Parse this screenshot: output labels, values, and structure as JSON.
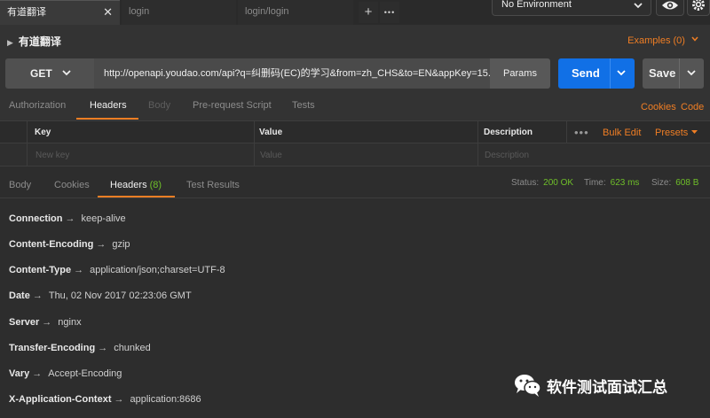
{
  "tabs": [
    {
      "label": "有道翻译",
      "active": true
    },
    {
      "label": "login",
      "active": false
    },
    {
      "label": "login/login",
      "active": false
    }
  ],
  "tab_actions": {
    "new_tab": "+",
    "more": "•••"
  },
  "environment": {
    "selected": "No Environment"
  },
  "request": {
    "title": "有道翻译",
    "examples_label": "Examples (0)",
    "method": "GET",
    "url": "http://openapi.youdao.com/api?q=纠删码(EC)的学习&from=zh_CHS&to=EN&appKey=15...",
    "params_label": "Params",
    "send_label": "Send",
    "save_label": "Save"
  },
  "request_tabs": [
    "Authorization",
    "Headers",
    "Body",
    "Pre-request Script",
    "Tests"
  ],
  "request_tab_links": {
    "cookies": "Cookies",
    "code": "Code"
  },
  "headers_table": {
    "columns": [
      "Key",
      "Value",
      "Description"
    ],
    "placeholders": {
      "key": "New key",
      "value": "Value",
      "description": "Description"
    },
    "more": "•••",
    "bulk_edit": "Bulk Edit",
    "presets": "Presets"
  },
  "response_tabs": [
    "Body",
    "Cookies",
    "Headers",
    "Test Results"
  ],
  "response_headers_count": "(8)",
  "response_status": {
    "status_label": "Status:",
    "status_value": "200 OK",
    "time_label": "Time:",
    "time_value": "623 ms",
    "size_label": "Size:",
    "size_value": "608 B"
  },
  "response_headers": [
    {
      "key": "Connection",
      "value": "keep-alive"
    },
    {
      "key": "Content-Encoding",
      "value": "gzip"
    },
    {
      "key": "Content-Type",
      "value": "application/json;charset=UTF-8"
    },
    {
      "key": "Date",
      "value": "Thu, 02 Nov 2017 02:23:06 GMT"
    },
    {
      "key": "Server",
      "value": "nginx"
    },
    {
      "key": "Transfer-Encoding",
      "value": "chunked"
    },
    {
      "key": "Vary",
      "value": "Accept-Encoding"
    },
    {
      "key": "X-Application-Context",
      "value": "application:8686"
    }
  ],
  "header_arrow": "→",
  "watermark": {
    "text": "软件测试面试汇总",
    "icon": "wechat-icon"
  },
  "colors": {
    "accent": "#f07e24",
    "send": "#1170e6",
    "success": "#6fbf29"
  }
}
